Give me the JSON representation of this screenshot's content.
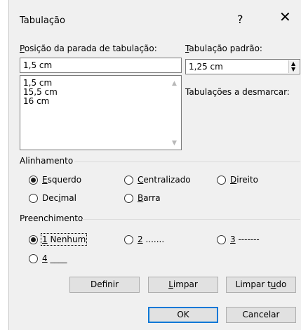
{
  "dialog": {
    "title": "Tabulação",
    "help": "?",
    "close": "✕"
  },
  "tab_stop": {
    "label_underlined": "P",
    "label_rest": "osição da parada de tabulação:",
    "value": "1,5 cm",
    "list": [
      "1,5 cm",
      "15,5 cm",
      "16 cm"
    ]
  },
  "default_tab": {
    "label_underlined": "T",
    "label_rest": "abulação padrão:",
    "value": "1,25 cm"
  },
  "to_clear": {
    "label": "Tabulações a desmarcar:"
  },
  "alignment": {
    "label": "Alinhamento",
    "options": [
      {
        "u": "E",
        "rest": "squerdo",
        "checked": true
      },
      {
        "u": "C",
        "rest": "entralizado",
        "checked": false
      },
      {
        "u": "D",
        "rest": "ireito",
        "checked": false
      },
      {
        "pre": "Dec",
        "u": "i",
        "rest": "mal",
        "checked": false
      },
      {
        "u": "B",
        "rest": "arra",
        "checked": false
      }
    ]
  },
  "leader": {
    "label": "Preenchimento",
    "options": [
      {
        "u": "1",
        "rest": " Nenhum",
        "checked": true
      },
      {
        "u": "2",
        "rest": " .......",
        "checked": false
      },
      {
        "u": "3",
        "rest": " -------",
        "checked": false
      },
      {
        "u": "4",
        "rest": " ____",
        "checked": false
      }
    ]
  },
  "buttons": {
    "set": {
      "pre": "Def",
      "u": "i",
      "rest": "nir"
    },
    "clear": {
      "pre": "",
      "u": "L",
      "rest": "impar"
    },
    "clear_all": {
      "pre": "Limpar t",
      "u": "u",
      "rest": "do"
    },
    "ok": "OK",
    "cancel": "Cancelar"
  },
  "icons": {
    "scroll_up": "▲",
    "scroll_down": "▼",
    "spin_up": "▲",
    "spin_down": "▼"
  }
}
